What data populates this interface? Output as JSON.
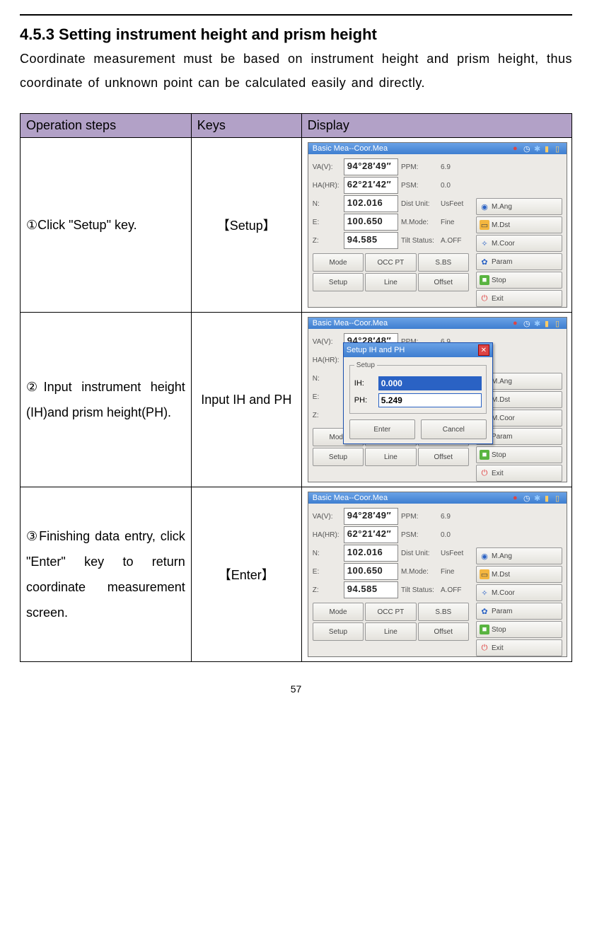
{
  "section": {
    "title": "4.5.3 Setting instrument height and prism height",
    "intro": "Coordinate measurement must be based on instrument height and prism height, thus coordinate of unknown point can be calculated easily and directly."
  },
  "table": {
    "headers": {
      "ops": "Operation steps",
      "keys": "Keys",
      "display": "Display"
    },
    "rows": [
      {
        "op": "①Click \"Setup\" key.",
        "key": "【Setup】"
      },
      {
        "op": "②Input instrument height (IH)and prism height(PH).",
        "key": "Input IH and PH"
      },
      {
        "op": "③Finishing data entry, click \"Enter\" key to return coordinate measurement screen.",
        "key": "【Enter】"
      }
    ]
  },
  "screen_common": {
    "title": "Basic Mea--Coor.Mea",
    "labels": {
      "va": "VA(V):",
      "ha": "HA(HR):",
      "n": "N:",
      "e": "E:",
      "z": "Z:",
      "ppm": "PPM:",
      "psm": "PSM:",
      "dist": "Dist Unit:",
      "mmode": "M.Mode:",
      "tilt": "Tilt Status:"
    },
    "side_values": {
      "ppm": "6.9",
      "psm": "0.0",
      "dist": "UsFeet",
      "mmode": "Fine",
      "tilt": "A.OFF"
    },
    "buttons": {
      "mang": "M.Ang",
      "mdst": "M.Dst",
      "mcoor": "M.Coor",
      "param": "Param",
      "stop": "Stop",
      "exit": "Exit",
      "mode": "Mode",
      "occpt": "OCC PT",
      "sbs": "S.BS",
      "setup": "Setup",
      "line": "Line",
      "offset": "Offset"
    }
  },
  "screen1": {
    "va": "94°28′49″",
    "ha": "62°21′42″",
    "n": "102.016",
    "e": "100.650",
    "z": "94.585"
  },
  "screen2": {
    "va": "94°28′48″",
    "ha": "",
    "n": "",
    "e": "",
    "z": "",
    "dialog": {
      "title": "Setup IH and PH",
      "legend": "Setup",
      "ih_label": "IH:",
      "ih_value": "0.000",
      "ph_label": "PH:",
      "ph_value": "5.249",
      "enter": "Enter",
      "cancel": "Cancel"
    }
  },
  "screen3": {
    "va": "94°28′49″",
    "ha": "62°21′42″",
    "n": "102.016",
    "e": "100.650",
    "z": "94.585"
  },
  "page_number": "57"
}
